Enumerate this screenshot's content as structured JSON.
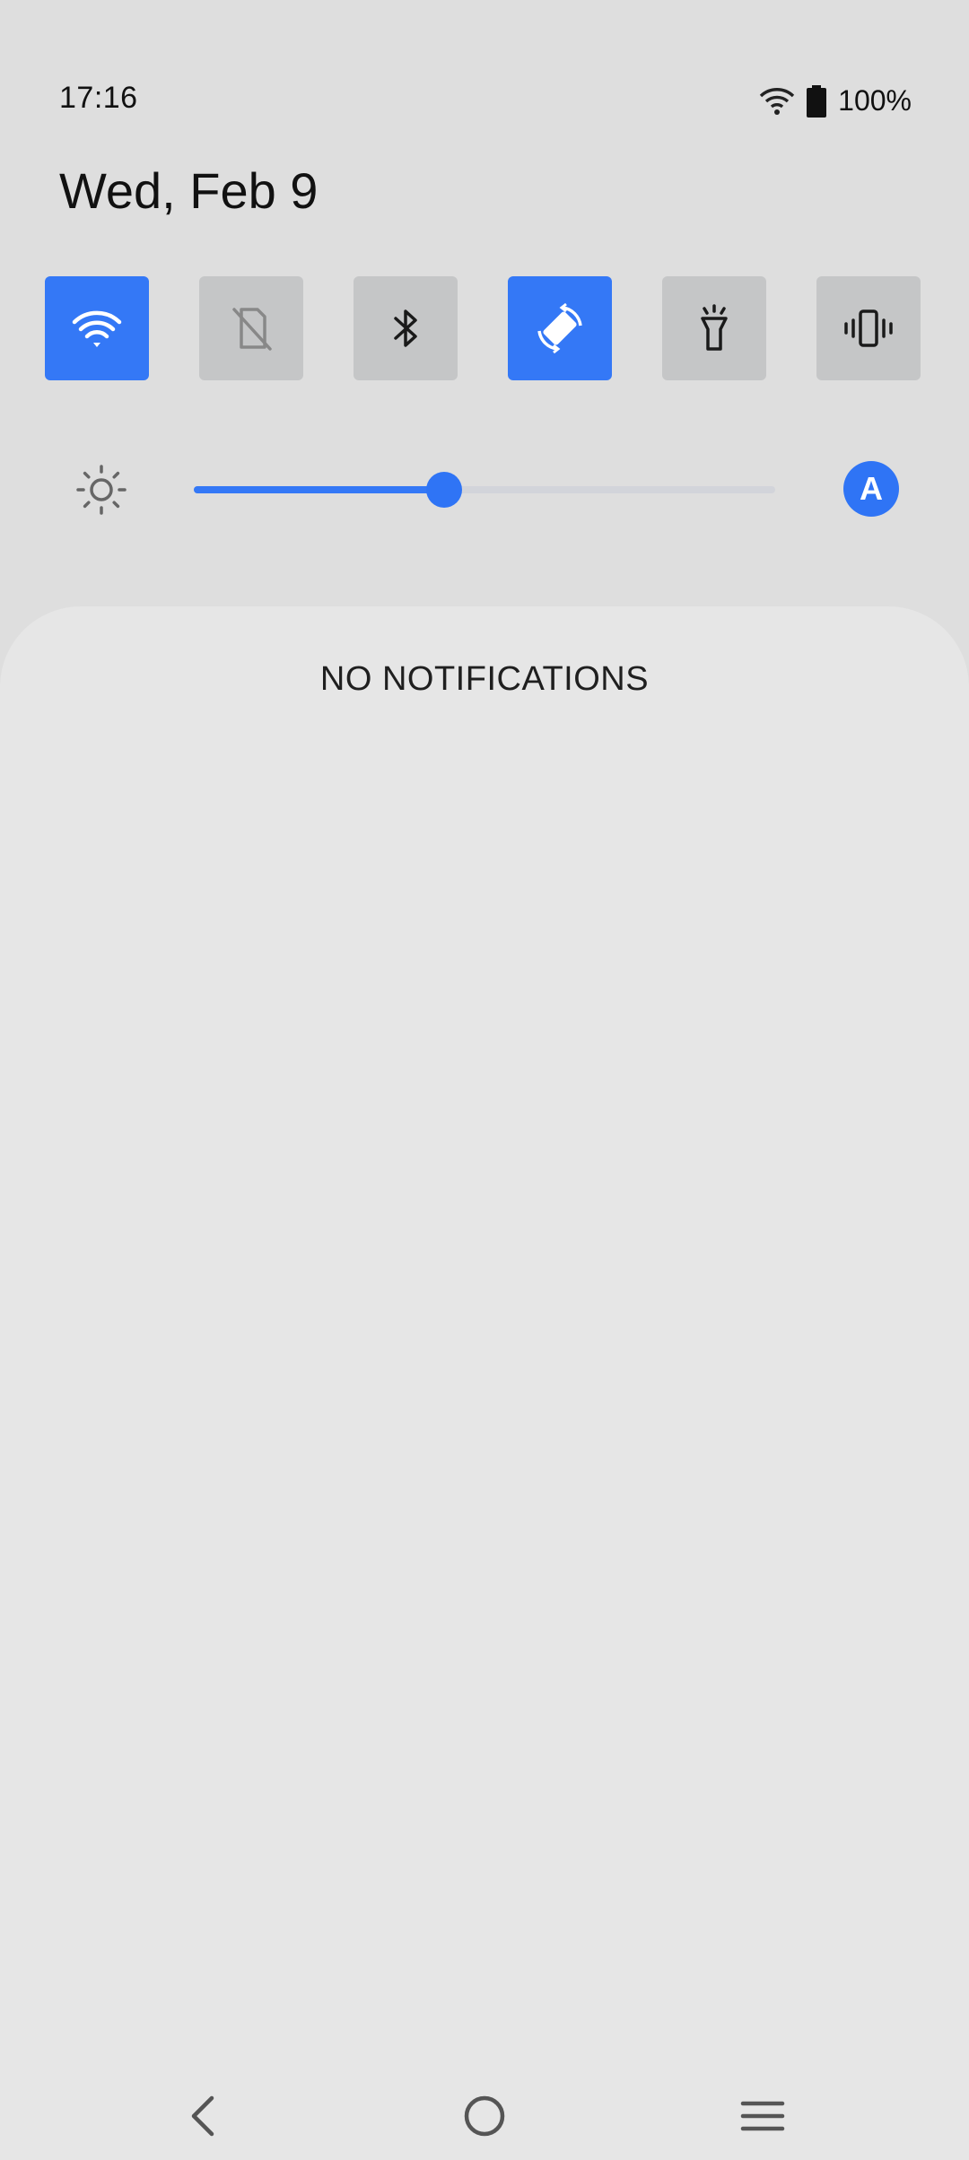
{
  "status_bar": {
    "time": "17:16",
    "battery": "100%",
    "icons": [
      "wifi-icon",
      "battery-icon"
    ]
  },
  "header": {
    "date": "Wed, Feb 9"
  },
  "quick_settings": {
    "tiles": [
      {
        "name": "wifi",
        "icon": "wifi-icon",
        "active": true
      },
      {
        "name": "mobile-data",
        "icon": "no-sim-icon",
        "active": false
      },
      {
        "name": "bluetooth",
        "icon": "bluetooth-icon",
        "active": false
      },
      {
        "name": "auto-rotate",
        "icon": "auto-rotate-icon",
        "active": true
      },
      {
        "name": "flashlight",
        "icon": "flashlight-icon",
        "active": false
      },
      {
        "name": "vibrate",
        "icon": "vibrate-icon",
        "active": false
      }
    ],
    "active_color": "#3478f6",
    "inactive_color": "#c5c6c7"
  },
  "brightness": {
    "level_fraction": 0.43,
    "auto_label": "A",
    "icon": "brightness-icon"
  },
  "notifications": {
    "empty_label": "NO NOTIFICATIONS"
  },
  "nav_bar": {
    "buttons": [
      "back-icon",
      "home-icon",
      "menu-icon"
    ]
  }
}
